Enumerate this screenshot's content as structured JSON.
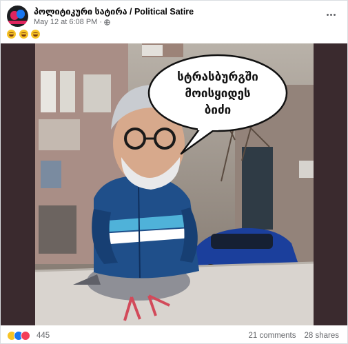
{
  "post": {
    "page_name": "პოლიტიკური სატირა / Political Satire",
    "timestamp": "May 12 at 6:08 PM",
    "separator": "·",
    "privacy_icon": "globe-icon",
    "caption_emojis": [
      "laughing-face-emoji",
      "laughing-face-emoji",
      "laughing-face-emoji"
    ]
  },
  "image": {
    "speech_bubble_lines": [
      "სტრასბურგში",
      "მოისყიდეს",
      "ბიძი"
    ]
  },
  "footer": {
    "reaction_icons": [
      "haha-reaction-icon",
      "like-reaction-icon",
      "love-reaction-icon"
    ],
    "reaction_count": "445",
    "comments": "21 comments",
    "shares": "28 shares"
  },
  "colors": {
    "accent": "#1877f2",
    "meta_text": "#65676b",
    "jacket_blue": "#1f4f8a",
    "jacket_light": "#4fb2d9"
  }
}
